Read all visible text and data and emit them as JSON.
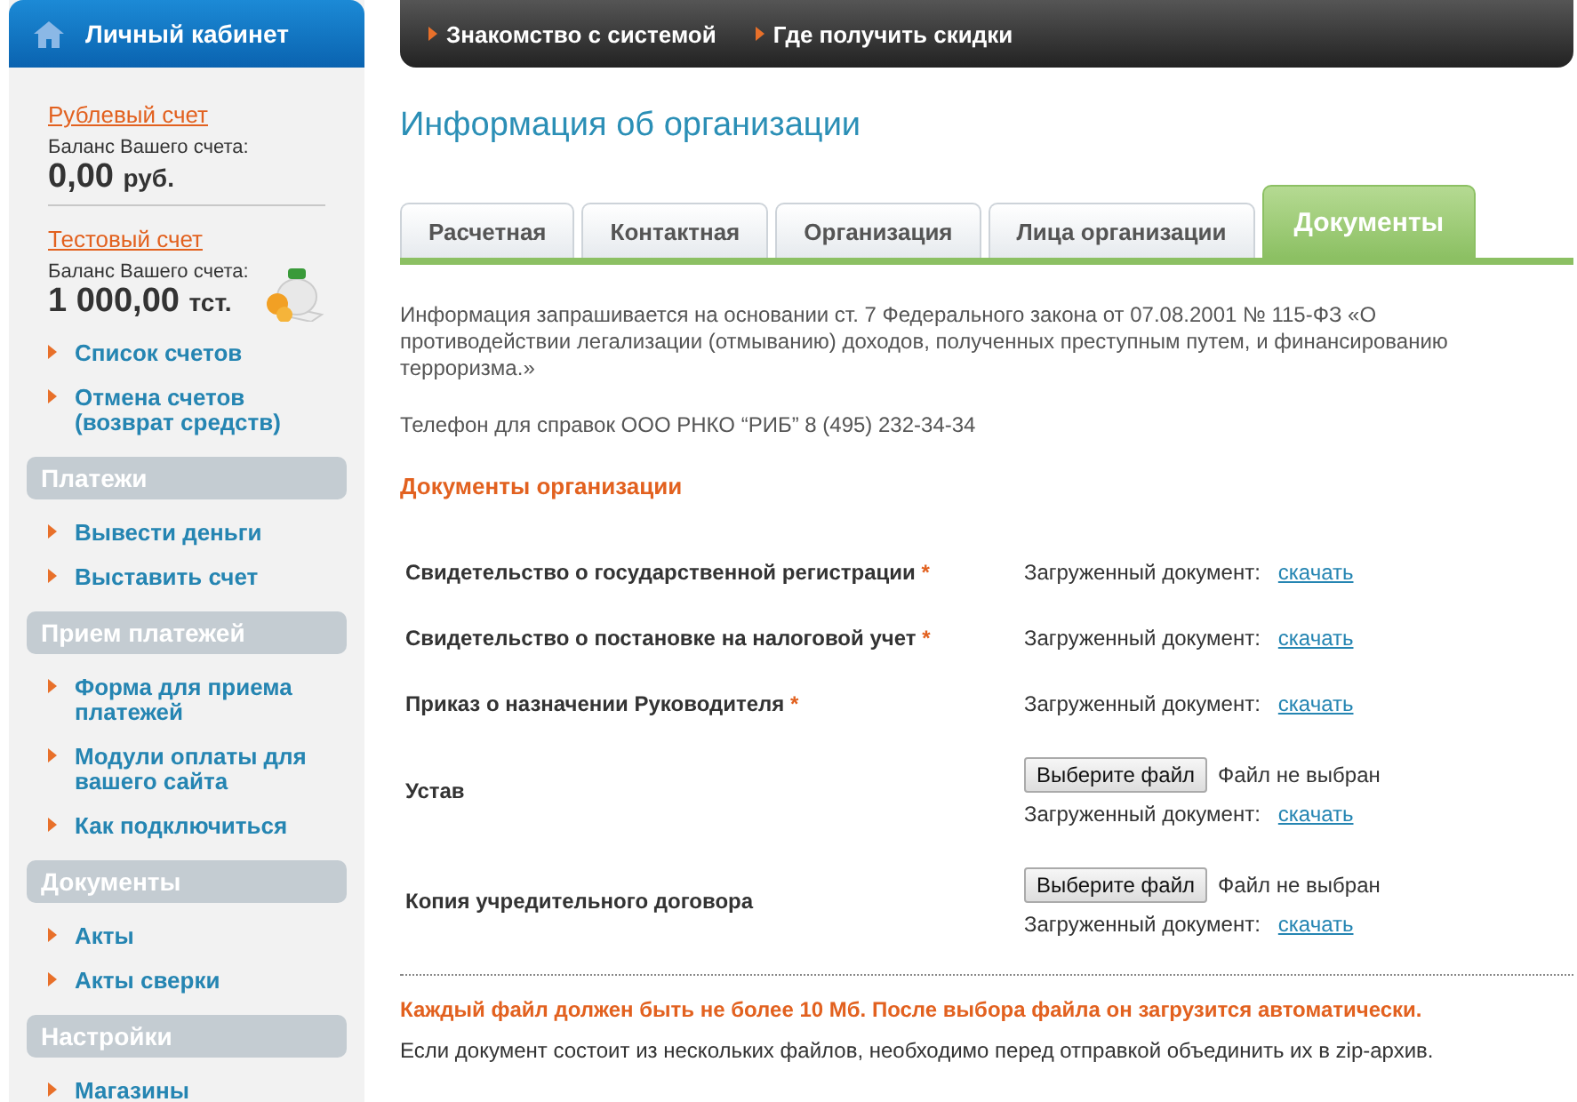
{
  "sidebar": {
    "title": "Личный кабинет",
    "accounts": [
      {
        "name": "Рублевый счет",
        "balance_label": "Баланс Вашего счета:",
        "amount": "0,00",
        "currency": "руб."
      },
      {
        "name": "Тестовый счет",
        "balance_label": "Баланс Вашего счета:",
        "amount": "1 000,00",
        "currency": "тст."
      }
    ],
    "account_links": [
      "Список счетов",
      "Отмена счетов (возврат средств)"
    ],
    "sections": [
      {
        "title": "Платежи",
        "items": [
          "Вывести деньги",
          "Выставить счет"
        ]
      },
      {
        "title": "Прием платежей",
        "items": [
          "Форма для приема платежей",
          "Модули оплаты для вашего сайта",
          "Как подключиться"
        ]
      },
      {
        "title": "Документы",
        "items": [
          "Акты",
          "Акты сверки"
        ]
      },
      {
        "title": "Настройки",
        "items": [
          "Магазины"
        ]
      }
    ]
  },
  "top_nav": [
    "Знакомство с системой",
    "Где получить скидки"
  ],
  "page_title": "Информация об организации",
  "tabs": [
    {
      "label": "Расчетная",
      "selected": false
    },
    {
      "label": "Контактная",
      "selected": false
    },
    {
      "label": "Организация",
      "selected": false
    },
    {
      "label": "Лица организации",
      "selected": false
    },
    {
      "label": "Документы",
      "selected": true
    }
  ],
  "notice": "Информация запрашивается на основании ст. 7 Федерального закона от 07.08.2001 № 115-ФЗ «О противодействии легализации (отмыванию) доходов, полученных преступным путем, и финансированию терроризма.»",
  "phone": "Телефон для справок ООО РНКО “РИБ” 8 (495) 232-34-34",
  "section_title": "Документы организации",
  "documents": [
    {
      "kind": "uploaded",
      "label": "Свидетельство о государственной регистрации",
      "required_mark": "*",
      "uploaded_label": "Загруженный документ:",
      "download": "скачать"
    },
    {
      "kind": "uploaded",
      "label": "Свидетельство о постановке на налоговой учет",
      "required_mark": "*",
      "uploaded_label": "Загруженный документ:",
      "download": "скачать"
    },
    {
      "kind": "uploaded",
      "label": "Приказ о назначении Руководителя",
      "required_mark": "*",
      "uploaded_label": "Загруженный документ:",
      "download": "скачать"
    },
    {
      "kind": "upload",
      "label": "Устав",
      "button": "Выберите файл",
      "file_status": "Файл не выбран",
      "uploaded_label": "Загруженный документ:",
      "download": "скачать"
    },
    {
      "kind": "upload",
      "label": "Копия учредительного договора",
      "button": "Выберите файл",
      "file_status": "Файл не выбран",
      "uploaded_label": "Загруженный документ:",
      "download": "скачать"
    }
  ],
  "footer_warning": "Каждый файл должен быть не более 10 Мб. После выбора файла он загрузится автоматически.",
  "footer_note": "Если документ состоит из нескольких файлов, необходимо перед отправкой объединить их в zip-архив."
}
